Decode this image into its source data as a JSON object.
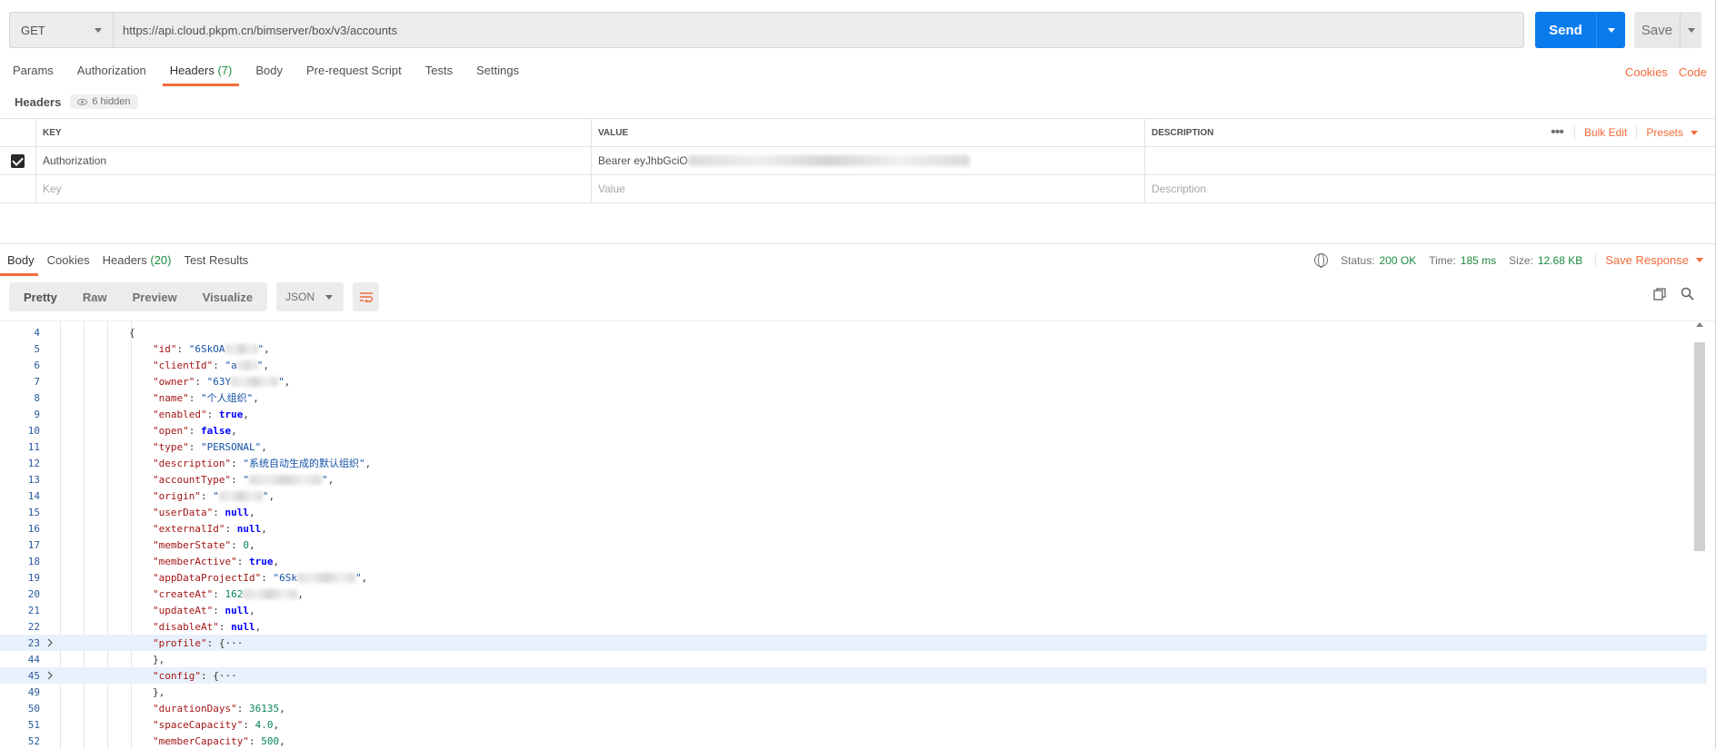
{
  "request": {
    "method": "GET",
    "url": "https://api.cloud.pkpm.cn/bimserver/box/v3/accounts",
    "send_label": "Send",
    "save_label": "Save"
  },
  "req_tabs": [
    {
      "label": "Params",
      "count": ""
    },
    {
      "label": "Authorization",
      "count": ""
    },
    {
      "label": "Headers",
      "count": "(7)"
    },
    {
      "label": "Body",
      "count": ""
    },
    {
      "label": "Pre-request Script",
      "count": ""
    },
    {
      "label": "Tests",
      "count": ""
    },
    {
      "label": "Settings",
      "count": ""
    }
  ],
  "right_links": {
    "cookies": "Cookies",
    "code": "Code"
  },
  "headers_section": {
    "title": "Headers",
    "hidden": "6 hidden"
  },
  "table": {
    "col_key": "KEY",
    "col_value": "VALUE",
    "col_desc": "DESCRIPTION",
    "bulk_edit": "Bulk Edit",
    "presets": "Presets",
    "row1_key": "Authorization",
    "row1_value": "Bearer eyJhbGciO",
    "ph_key": "Key",
    "ph_value": "Value",
    "ph_desc": "Description"
  },
  "resp_tabs": [
    {
      "label": "Body",
      "count": ""
    },
    {
      "label": "Cookies",
      "count": ""
    },
    {
      "label": "Headers",
      "count": "(20)"
    },
    {
      "label": "Test Results",
      "count": ""
    }
  ],
  "status": {
    "status_label": "Status:",
    "status_value": "200 OK",
    "time_label": "Time:",
    "time_value": "185 ms",
    "size_label": "Size:",
    "size_value": "12.68 KB",
    "save_response": "Save Response"
  },
  "view_modes": [
    "Pretty",
    "Raw",
    "Preview",
    "Visualize"
  ],
  "format": "JSON",
  "code_lines": [
    {
      "n": "4",
      "indent": 1,
      "key": "",
      "val": "{",
      "kind": "p",
      "tail": ""
    },
    {
      "n": "5",
      "indent": 2,
      "key": "\"id\"",
      "val": "\"6SkOA",
      "kind": "s",
      "tail": "\",",
      "blur": 36
    },
    {
      "n": "6",
      "indent": 2,
      "key": "\"clientId\"",
      "val": "\"a",
      "kind": "s",
      "tail": "\",",
      "blur": 22
    },
    {
      "n": "7",
      "indent": 2,
      "key": "\"owner\"",
      "val": "\"63Y",
      "kind": "s",
      "tail": "\",",
      "blur": 52
    },
    {
      "n": "8",
      "indent": 2,
      "key": "\"name\"",
      "val": "\"个人组织\"",
      "kind": "s",
      "tail": ","
    },
    {
      "n": "9",
      "indent": 2,
      "key": "\"enabled\"",
      "val": "true",
      "kind": "b",
      "tail": ","
    },
    {
      "n": "10",
      "indent": 2,
      "key": "\"open\"",
      "val": "false",
      "kind": "b",
      "tail": ","
    },
    {
      "n": "11",
      "indent": 2,
      "key": "\"type\"",
      "val": "\"PERSONAL\"",
      "kind": "s",
      "tail": ","
    },
    {
      "n": "12",
      "indent": 2,
      "key": "\"description\"",
      "val": "\"系统自动生成的默认组织\"",
      "kind": "s",
      "tail": ","
    },
    {
      "n": "13",
      "indent": 2,
      "key": "\"accountType\"",
      "val": "\"",
      "kind": "s",
      "tail": "\",",
      "blur": 80
    },
    {
      "n": "14",
      "indent": 2,
      "key": "\"origin\"",
      "val": "\"",
      "kind": "s",
      "tail": "\",",
      "blur": 48
    },
    {
      "n": "15",
      "indent": 2,
      "key": "\"userData\"",
      "val": "null",
      "kind": "b",
      "tail": ","
    },
    {
      "n": "16",
      "indent": 2,
      "key": "\"externalId\"",
      "val": "null",
      "kind": "b",
      "tail": ","
    },
    {
      "n": "17",
      "indent": 2,
      "key": "\"memberState\"",
      "val": "0",
      "kind": "n",
      "tail": ","
    },
    {
      "n": "18",
      "indent": 2,
      "key": "\"memberActive\"",
      "val": "true",
      "kind": "b",
      "tail": ","
    },
    {
      "n": "19",
      "indent": 2,
      "key": "\"appDataProjectId\"",
      "val": "\"6Sk",
      "kind": "s",
      "tail": "\",",
      "blur": 64
    },
    {
      "n": "20",
      "indent": 2,
      "key": "\"createAt\"",
      "val": "162",
      "kind": "n",
      "tail": ",",
      "blur": 60
    },
    {
      "n": "21",
      "indent": 2,
      "key": "\"updateAt\"",
      "val": "null",
      "kind": "b",
      "tail": ","
    },
    {
      "n": "22",
      "indent": 2,
      "key": "\"disableAt\"",
      "val": "null",
      "kind": "b",
      "tail": ","
    },
    {
      "n": "23",
      "indent": 2,
      "key": "\"profile\"",
      "val": "{···",
      "kind": "p",
      "tail": "",
      "fold": true
    },
    {
      "n": "44",
      "indent": 2,
      "key": "",
      "val": "},",
      "kind": "p",
      "tail": ""
    },
    {
      "n": "45",
      "indent": 2,
      "key": "\"config\"",
      "val": "{···",
      "kind": "p",
      "tail": "",
      "fold": true
    },
    {
      "n": "49",
      "indent": 2,
      "key": "",
      "val": "},",
      "kind": "p",
      "tail": ""
    },
    {
      "n": "50",
      "indent": 2,
      "key": "\"durationDays\"",
      "val": "36135",
      "kind": "n",
      "tail": ","
    },
    {
      "n": "51",
      "indent": 2,
      "key": "\"spaceCapacity\"",
      "val": "4.0",
      "kind": "n",
      "tail": ","
    },
    {
      "n": "52",
      "indent": 2,
      "key": "\"memberCapacity\"",
      "val": "500",
      "kind": "n",
      "tail": ","
    }
  ]
}
